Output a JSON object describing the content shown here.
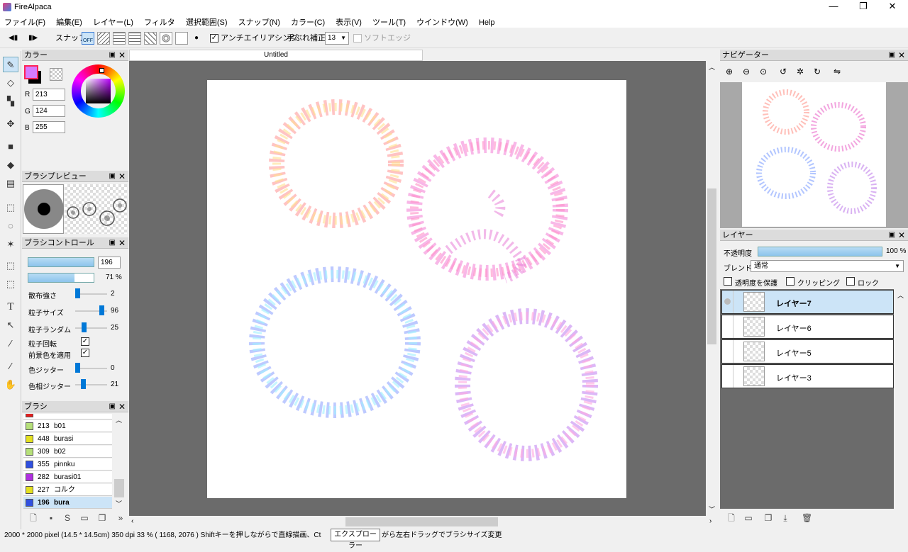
{
  "app": {
    "title": "FireAlpaca"
  },
  "menu": [
    "ファイル(F)",
    "編集(E)",
    "レイヤー(L)",
    "フィルタ",
    "選択範囲(S)",
    "スナップ(N)",
    "カラー(C)",
    "表示(V)",
    "ツール(T)",
    "ウインドウ(W)",
    "Help"
  ],
  "toolbar": {
    "snap_label": "スナップ",
    "snap_off": "OFF",
    "antialias": "アンチエイリアシング",
    "stabilizer_label": "手ぶれ補正",
    "stabilizer_value": "13",
    "soft_edge": "ソフトエッジ"
  },
  "doc": {
    "tab": "Untitled"
  },
  "color_panel": {
    "title": "カラー",
    "r_label": "R",
    "g_label": "G",
    "b_label": "B",
    "r": "213",
    "g": "124",
    "b": "255",
    "fg": "#d57cff"
  },
  "brush_preview": {
    "title": "ブラシプレビュー"
  },
  "brush_control": {
    "title": "ブラシコントロール",
    "size": "196",
    "opacity": "71 %",
    "params": [
      {
        "label": "散布強さ",
        "value": "2",
        "level": 0.1
      },
      {
        "label": "粒子サイズ",
        "value": "96",
        "level": 0.96
      },
      {
        "label": "粒子ランダム",
        "value": "25",
        "level": 0.25
      },
      {
        "label": "色ジッター",
        "value": "0",
        "level": 0.0
      },
      {
        "label": "色相ジッター",
        "value": "21",
        "level": 0.21
      }
    ],
    "checks": [
      {
        "label": "粒子回転",
        "checked": "✓"
      },
      {
        "label": "前景色を適用",
        "checked": "✓"
      }
    ]
  },
  "brush_list": {
    "title": "ブラシ",
    "items": [
      {
        "num": "213",
        "name": "b01",
        "color": "#b6e07a"
      },
      {
        "num": "448",
        "name": "burasi",
        "color": "#e4e020"
      },
      {
        "num": "309",
        "name": "b02",
        "color": "#b6e07a"
      },
      {
        "num": "355",
        "name": "pinnku",
        "color": "#3050e0"
      },
      {
        "num": "282",
        "name": "burasi01",
        "color": "#b030e0"
      },
      {
        "num": "227",
        "name": "コルク",
        "color": "#e4e020"
      },
      {
        "num": "196",
        "name": "bura",
        "color": "#3050e0",
        "selected": true
      }
    ]
  },
  "navigator": {
    "title": "ナビゲーター"
  },
  "layers": {
    "title": "レイヤー",
    "opacity_label": "不透明度",
    "opacity_value": "100 %",
    "blend_label": "ブレンド",
    "blend_value": "通常",
    "protect": "透明度を保護",
    "clipping": "クリッピング",
    "lock": "ロック",
    "items": [
      {
        "name": "レイヤー7",
        "selected": true
      },
      {
        "name": "レイヤー6"
      },
      {
        "name": "レイヤー5"
      },
      {
        "name": "レイヤー3"
      }
    ]
  },
  "status": {
    "text": "2000 * 2000 pixel   (14.5 * 14.5cm)   350 dpi   33 %   ( 1168, 2076 )   Shiftキーを押しながらで直線描画、Ct",
    "tooltip": "エクスプローラー",
    "text2": "がら左右ドラッグでブラシサイズ変更"
  },
  "colors": {
    "pink": "#f2a",
    "accent": "#0078d7",
    "selection": "#cce4f7"
  }
}
